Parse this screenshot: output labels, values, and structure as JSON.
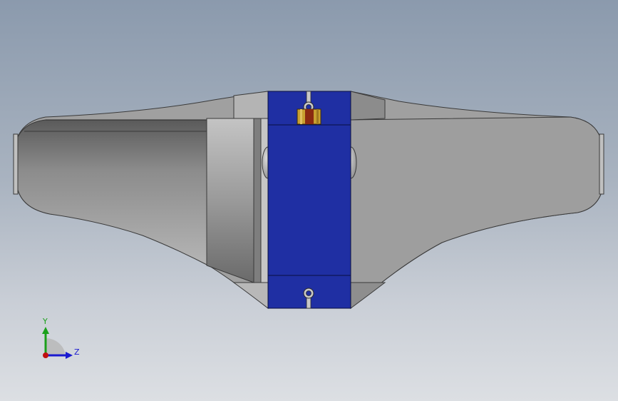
{
  "viewport": {
    "background_top": "#8b9aad",
    "background_bottom": "#dcdfe3"
  },
  "model": {
    "body_color": "#a3a3a3",
    "mount_color": "#1f2fa3",
    "edge_color": "#3a3a3a",
    "gear_colors": [
      "#c8a030",
      "#8a2a10"
    ]
  },
  "triad": {
    "y_label": "Y",
    "z_label": "Z",
    "y_color": "#1aa01a",
    "z_color": "#1a1ad0",
    "x_color": "#c01010"
  }
}
